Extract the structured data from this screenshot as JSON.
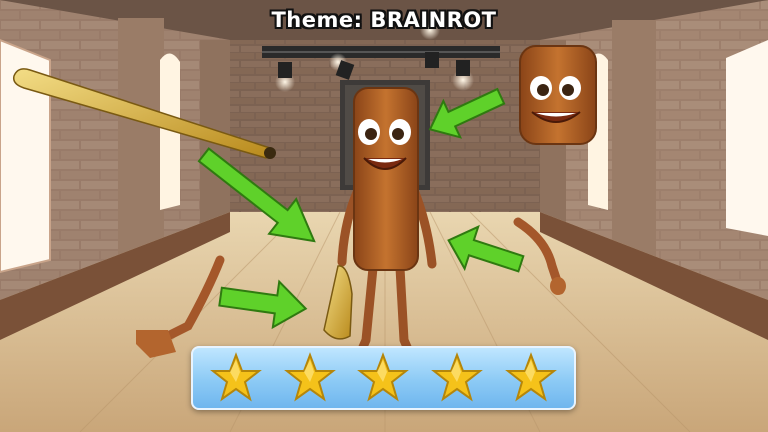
{
  "theme": {
    "label": "Theme: BRAINROT"
  },
  "rating": {
    "stars": [
      {
        "icon": "star-icon",
        "filled": true
      },
      {
        "icon": "star-icon",
        "filled": true
      },
      {
        "icon": "star-icon",
        "filled": true
      },
      {
        "icon": "star-icon",
        "filled": true
      },
      {
        "icon": "star-icon",
        "filled": true
      }
    ],
    "star_color": "#f5c21a"
  },
  "scene": {
    "wall_color": "#a88a74",
    "floor_color": "#d8bf96",
    "arrow_color": "#5fd12a",
    "character_color": "#b6642e"
  }
}
